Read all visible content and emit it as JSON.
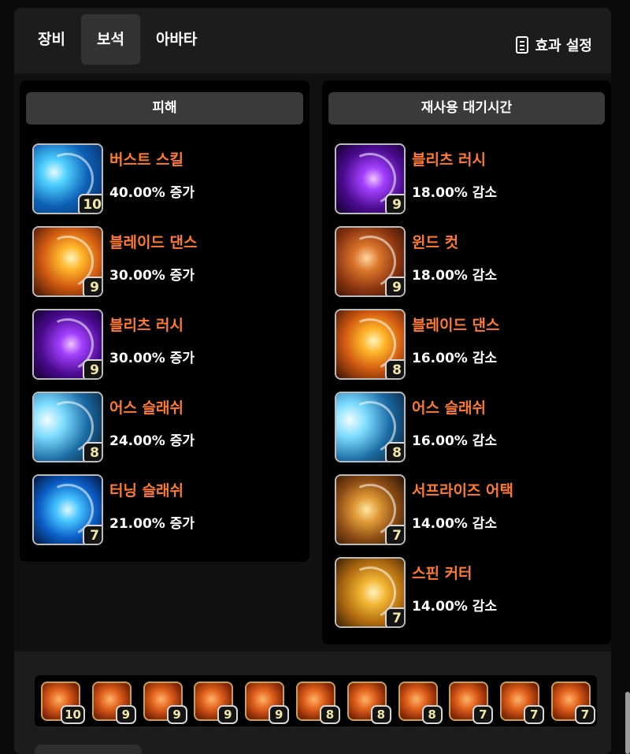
{
  "tabs": [
    {
      "label": "장비",
      "active": false
    },
    {
      "label": "보석",
      "active": true
    },
    {
      "label": "아바타",
      "active": false
    }
  ],
  "effect_settings": {
    "label": "효과 설정",
    "icon": "document-icon"
  },
  "damage_panel": {
    "title": "피해",
    "skills": [
      {
        "name": "버스트 스킬",
        "effect": "40.00% 증가",
        "level": "10",
        "art": "blue-burst"
      },
      {
        "name": "블레이드 댄스",
        "effect": "30.00% 증가",
        "level": "9",
        "art": "orange-blades"
      },
      {
        "name": "블리츠 러시",
        "effect": "30.00% 증가",
        "level": "9",
        "art": "purple-arc"
      },
      {
        "name": "어스 슬래쉬",
        "effect": "24.00% 증가",
        "level": "8",
        "art": "blue-wave"
      },
      {
        "name": "터닝 슬래쉬",
        "effect": "21.00% 증가",
        "level": "7",
        "art": "blue-ring"
      }
    ]
  },
  "cooldown_panel": {
    "title": "재사용 대기시간",
    "skills": [
      {
        "name": "블리츠 러시",
        "effect": "18.00% 감소",
        "level": "9",
        "art": "purple-arc"
      },
      {
        "name": "윈드 컷",
        "effect": "18.00% 감소",
        "level": "9",
        "art": "rust-wind"
      },
      {
        "name": "블레이드 댄스",
        "effect": "16.00% 감소",
        "level": "8",
        "art": "orange-blades"
      },
      {
        "name": "어스 슬래쉬",
        "effect": "16.00% 감소",
        "level": "8",
        "art": "blue-wave"
      },
      {
        "name": "서프라이즈 어택",
        "effect": "14.00% 감소",
        "level": "7",
        "art": "amber-swirl"
      },
      {
        "name": "스핀 커터",
        "effect": "14.00% 감소",
        "level": "7",
        "art": "gold-spin"
      }
    ]
  },
  "gem_bar": {
    "gems": [
      {
        "level": "10"
      },
      {
        "level": "9"
      },
      {
        "level": "9"
      },
      {
        "level": "9"
      },
      {
        "level": "9"
      },
      {
        "level": "8"
      },
      {
        "level": "8"
      },
      {
        "level": "8"
      },
      {
        "level": "7"
      },
      {
        "level": "7"
      },
      {
        "level": "7"
      }
    ]
  },
  "colors": {
    "skill_name": "#ff7a2e",
    "level_text": "#f0e7a6",
    "panel_header": "#3a3a3c",
    "gem_border": "#c9a055"
  }
}
